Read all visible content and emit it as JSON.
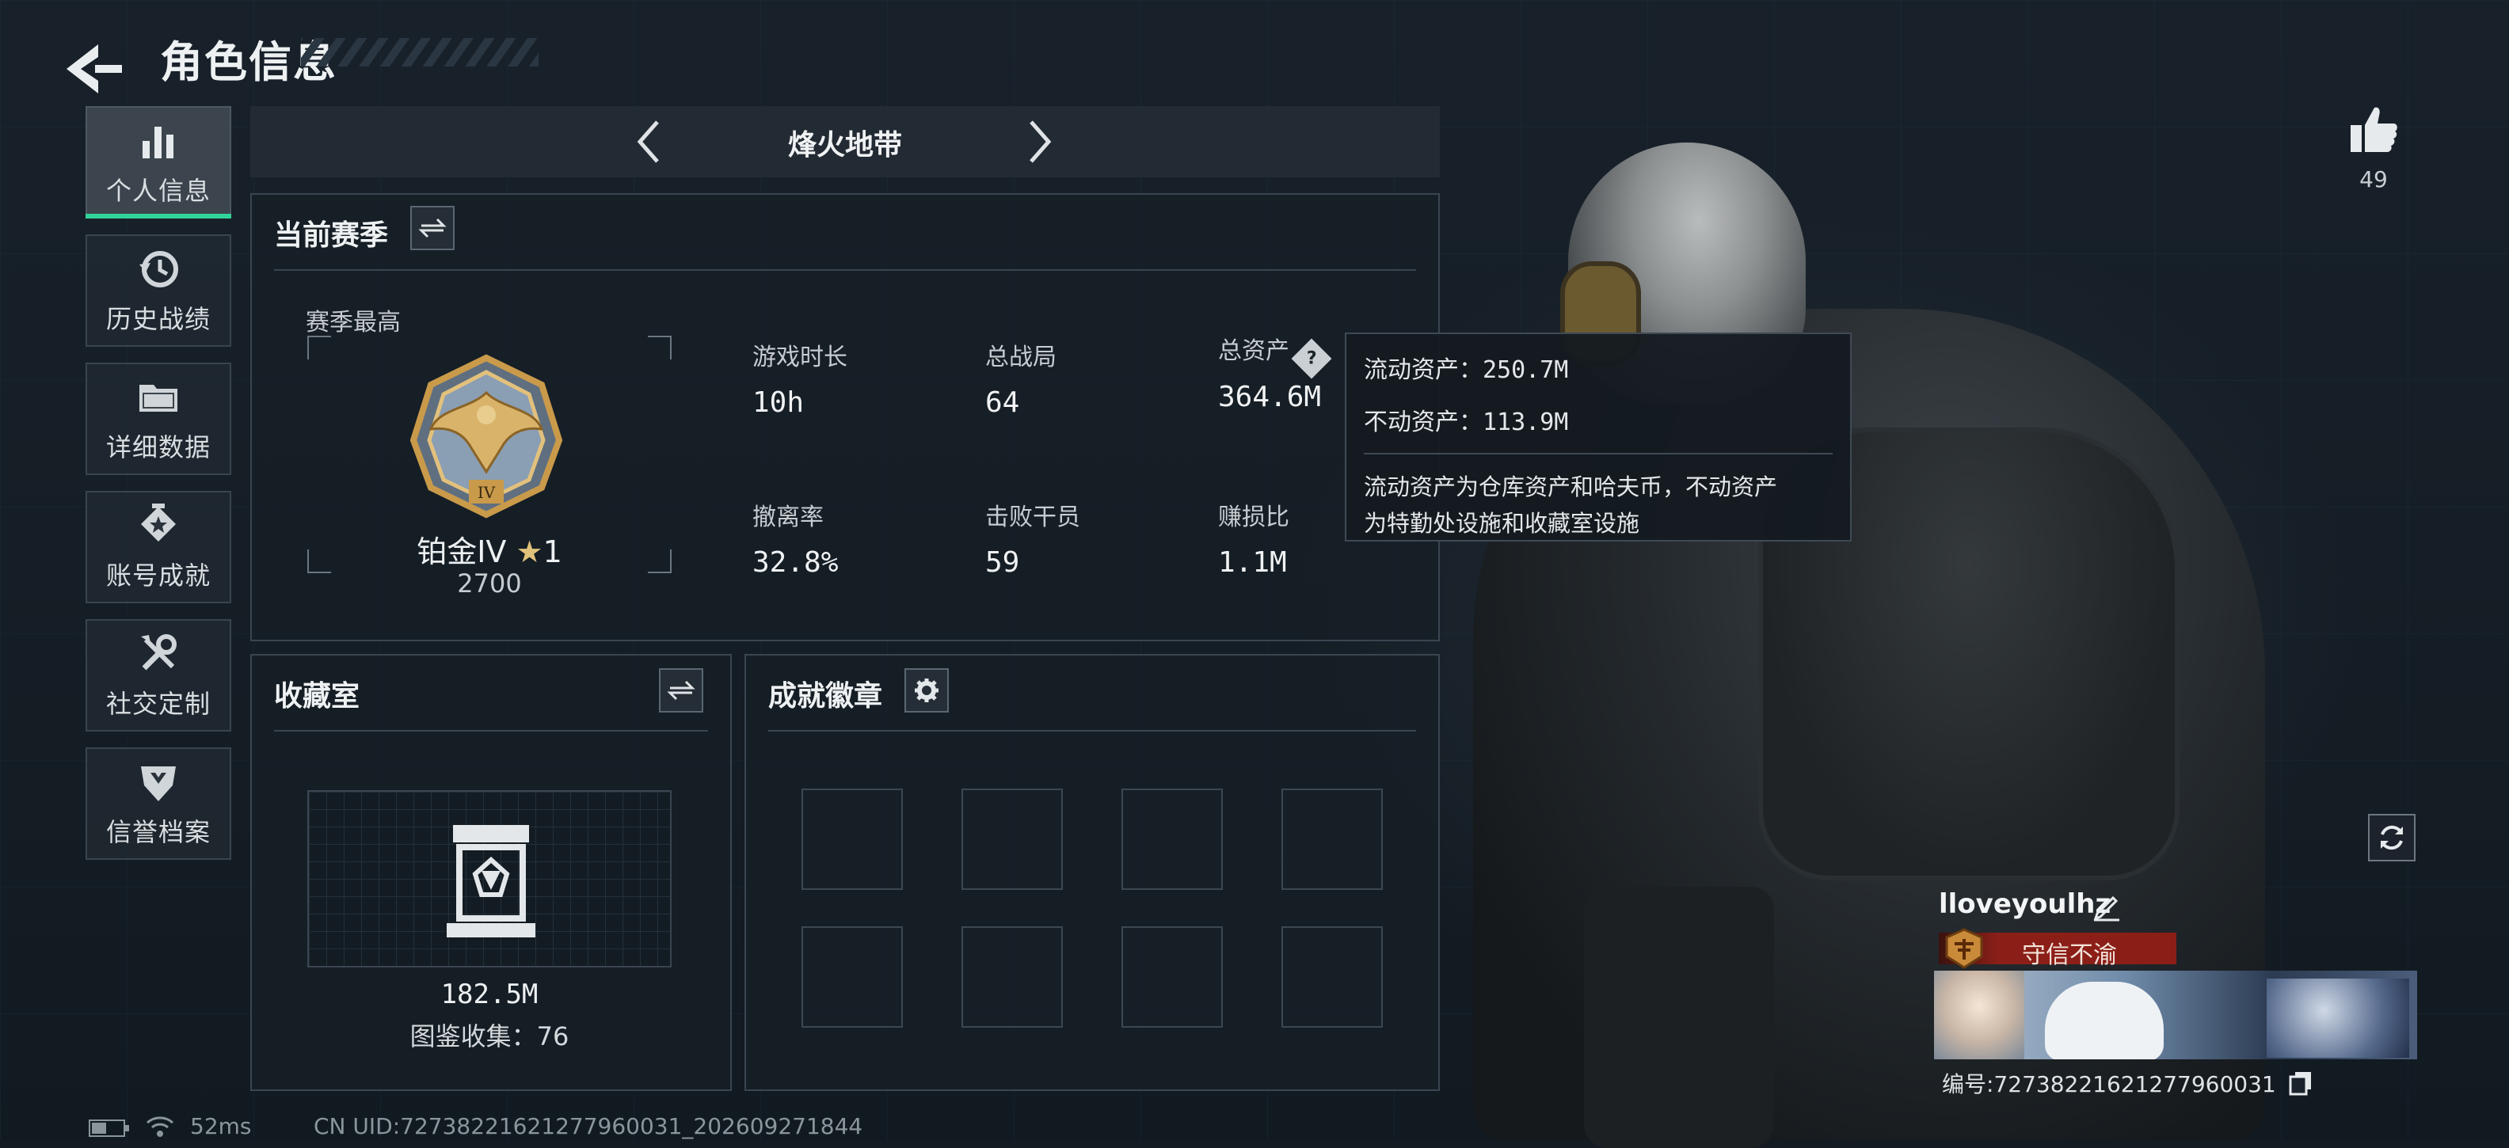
{
  "header": {
    "title": "角色信息"
  },
  "nav": {
    "items": [
      {
        "label": "个人信息",
        "icon": "bar-chart-icon",
        "active": true
      },
      {
        "label": "历史战绩",
        "icon": "history-icon"
      },
      {
        "label": "详细数据",
        "icon": "folder-icon"
      },
      {
        "label": "账号成就",
        "icon": "achievement-icon"
      },
      {
        "label": "社交定制",
        "icon": "tools-icon"
      },
      {
        "label": "信誉档案",
        "icon": "shield-icon"
      }
    ]
  },
  "mode": {
    "title": "烽火地带"
  },
  "season": {
    "title": "当前赛季",
    "subtitle": "赛季最高",
    "rank_name": "铂金IV",
    "rank_stars": "1",
    "rank_score": "2700",
    "stats": [
      {
        "label": "游戏时长",
        "value": "10h"
      },
      {
        "label": "总战局",
        "value": "64"
      },
      {
        "label": "总资产",
        "value": "364.6M"
      },
      {
        "label": "撤离率",
        "value": "32.8%"
      },
      {
        "label": "击败干员",
        "value": "59"
      },
      {
        "label": "赚损比",
        "value": "1.1M"
      }
    ]
  },
  "tooltip": {
    "liquid": "流动资产：250.7M",
    "fixed": "不动资产：113.9M",
    "desc1": "流动资产为仓库资产和哈夫币，不动资产",
    "desc2": "为特勤处设施和收藏室设施"
  },
  "collection": {
    "title": "收藏室",
    "value": "182.5M",
    "count": "图鉴收集：76"
  },
  "badges": {
    "title": "成就徽章"
  },
  "profile": {
    "likes": "49",
    "name": "lloveyoulhz",
    "title_badge": "守信不渝",
    "uid": "编号:7273822162127796003​1"
  },
  "status": {
    "ping": "52ms",
    "cn_uid": "CN UID:727382216212779600​31_202609271844"
  },
  "colors": {
    "accent": "#31d39a",
    "badge_red": "#8b1f18",
    "gold": "#c99a4a"
  }
}
